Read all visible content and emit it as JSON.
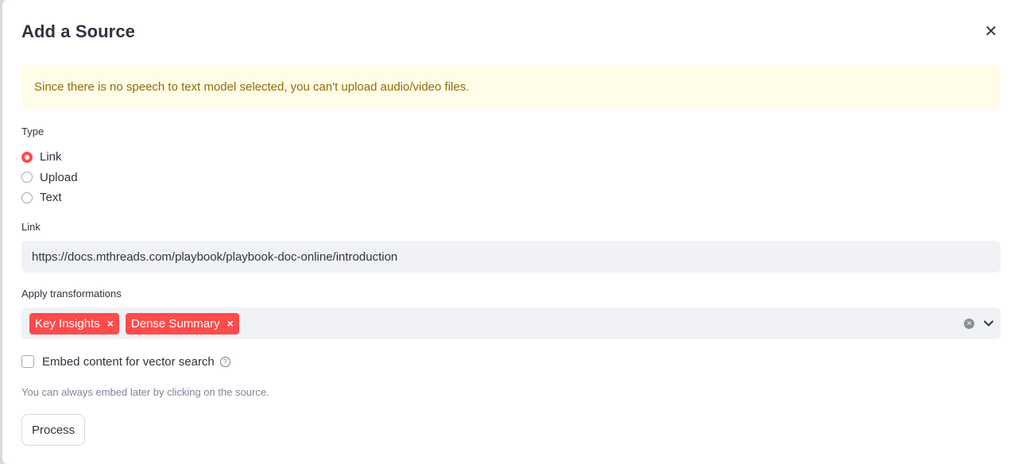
{
  "dialog": {
    "title": "Add a Source",
    "close_icon": "close-icon"
  },
  "alert": {
    "message": "Since there is no speech to text model selected, you can't upload audio/video files."
  },
  "type": {
    "label": "Type",
    "options": [
      {
        "label": "Link",
        "selected": true
      },
      {
        "label": "Upload",
        "selected": false
      },
      {
        "label": "Text",
        "selected": false
      }
    ]
  },
  "link": {
    "label": "Link",
    "value": "https://docs.mthreads.com/playbook/playbook-doc-online/introduction"
  },
  "transformations": {
    "label": "Apply transformations",
    "selected": [
      "Key Insights",
      "Dense Summary"
    ],
    "chip_remove_glyph": "×"
  },
  "embed": {
    "label": "Embed content for vector search",
    "checked": false,
    "help_icon": "help-circle-icon",
    "caption": "You can always embed later by clicking on the source."
  },
  "actions": {
    "process_label": "Process"
  },
  "colors": {
    "accent": "#ff4b4b",
    "alert_bg": "#fffce7",
    "alert_text": "#926c05",
    "input_bg": "#f0f2f6"
  }
}
